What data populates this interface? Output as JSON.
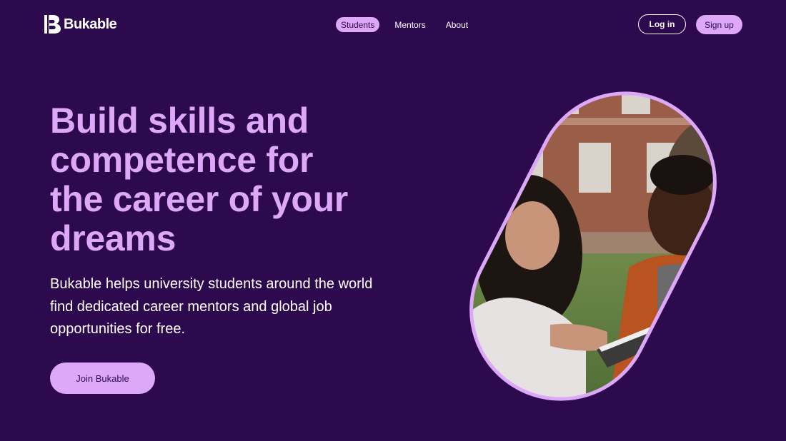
{
  "brand": {
    "name": "Bukable",
    "logo_icon": "bukable-b-logo-icon"
  },
  "nav": {
    "items": [
      {
        "label": "Students",
        "active": true
      },
      {
        "label": "Mentors",
        "active": false
      },
      {
        "label": "About",
        "active": false
      }
    ]
  },
  "auth": {
    "login_label": "Log in",
    "signup_label": "Sign up"
  },
  "hero": {
    "headline_lines": [
      "Build skills and",
      "competence for",
      "the career of your",
      "dreams"
    ],
    "subtext_lines": [
      "Bukable helps university students around the world",
      "find dedicated career mentors and global job",
      "opportunities for free."
    ],
    "cta_label": "Join Bukable",
    "image": "photo-students-studying-outdoors"
  },
  "colors": {
    "background": "#2d0a4e",
    "accent": "#dca8f7",
    "text": "#ffffff"
  }
}
